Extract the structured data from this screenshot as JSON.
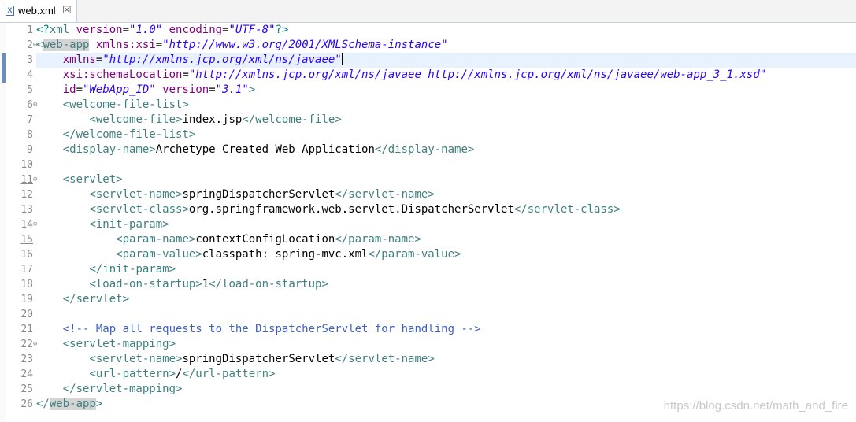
{
  "tab": {
    "title": "web.xml",
    "icon": "xml-file-icon",
    "close": "☒"
  },
  "watermark": "https://blog.csdn.net/math_and_fire",
  "lines": [
    {
      "n": "1",
      "fold": false,
      "u": false,
      "cur": false,
      "tokens": [
        [
          "pi",
          "<?"
        ],
        [
          "tag",
          "xml "
        ],
        [
          "attr",
          "version"
        ],
        [
          "txt",
          "="
        ],
        [
          "val",
          "\"1.0\""
        ],
        [
          "txt",
          " "
        ],
        [
          "attr",
          "encoding"
        ],
        [
          "txt",
          "="
        ],
        [
          "val",
          "\"UTF-8\""
        ],
        [
          "pi",
          "?>"
        ]
      ]
    },
    {
      "n": "2",
      "fold": true,
      "u": false,
      "cur": false,
      "tokens": [
        [
          "tag",
          "<"
        ],
        [
          "tag-hl",
          "web-app"
        ],
        [
          "txt",
          " "
        ],
        [
          "attr",
          "xmlns:xsi"
        ],
        [
          "txt",
          "="
        ],
        [
          "val",
          "\"http://www.w3.org/2001/XMLSchema-instance\""
        ]
      ]
    },
    {
      "n": "3",
      "fold": false,
      "u": false,
      "cur": true,
      "tokens": [
        [
          "txt",
          "    "
        ],
        [
          "attr",
          "xmlns"
        ],
        [
          "txt",
          "="
        ],
        [
          "val",
          "\"http://xmlns.jcp.org/xml/ns/javaee\""
        ],
        [
          "caret",
          ""
        ]
      ]
    },
    {
      "n": "4",
      "fold": false,
      "u": false,
      "cur": false,
      "tokens": [
        [
          "txt",
          "    "
        ],
        [
          "attr",
          "xsi:schemaLocation"
        ],
        [
          "txt",
          "="
        ],
        [
          "val",
          "\"http://xmlns.jcp.org/xml/ns/javaee http://xmlns.jcp.org/xml/ns/javaee/web-app_3_1.xsd\""
        ]
      ]
    },
    {
      "n": "5",
      "fold": false,
      "u": false,
      "cur": false,
      "tokens": [
        [
          "txt",
          "    "
        ],
        [
          "attr",
          "id"
        ],
        [
          "txt",
          "="
        ],
        [
          "val",
          "\"WebApp_ID\""
        ],
        [
          "txt",
          " "
        ],
        [
          "attr",
          "version"
        ],
        [
          "txt",
          "="
        ],
        [
          "val",
          "\"3.1\""
        ],
        [
          "tag",
          ">"
        ]
      ]
    },
    {
      "n": "6",
      "fold": true,
      "u": false,
      "cur": false,
      "tokens": [
        [
          "txt",
          "    "
        ],
        [
          "tag",
          "<welcome-file-list>"
        ]
      ]
    },
    {
      "n": "7",
      "fold": false,
      "u": false,
      "cur": false,
      "tokens": [
        [
          "txt",
          "        "
        ],
        [
          "tag",
          "<welcome-file>"
        ],
        [
          "txt",
          "index.jsp"
        ],
        [
          "tag",
          "</welcome-file>"
        ]
      ]
    },
    {
      "n": "8",
      "fold": false,
      "u": false,
      "cur": false,
      "tokens": [
        [
          "txt",
          "    "
        ],
        [
          "tag",
          "</welcome-file-list>"
        ]
      ]
    },
    {
      "n": "9",
      "fold": false,
      "u": false,
      "cur": false,
      "tokens": [
        [
          "txt",
          "    "
        ],
        [
          "tag",
          "<display-name>"
        ],
        [
          "txt",
          "Archetype Created Web Application"
        ],
        [
          "tag",
          "</display-name>"
        ]
      ]
    },
    {
      "n": "10",
      "fold": false,
      "u": false,
      "cur": false,
      "tokens": []
    },
    {
      "n": "11",
      "fold": true,
      "u": true,
      "cur": false,
      "tokens": [
        [
          "txt",
          "    "
        ],
        [
          "tag",
          "<servlet>"
        ]
      ]
    },
    {
      "n": "12",
      "fold": false,
      "u": false,
      "cur": false,
      "tokens": [
        [
          "txt",
          "        "
        ],
        [
          "tag",
          "<servlet-name>"
        ],
        [
          "txt",
          "springDispatcherServlet"
        ],
        [
          "tag",
          "</servlet-name>"
        ]
      ]
    },
    {
      "n": "13",
      "fold": false,
      "u": false,
      "cur": false,
      "tokens": [
        [
          "txt",
          "        "
        ],
        [
          "tag",
          "<servlet-class>"
        ],
        [
          "txt",
          "org.springframework.web.servlet.DispatcherServlet"
        ],
        [
          "tag",
          "</servlet-class>"
        ]
      ]
    },
    {
      "n": "14",
      "fold": true,
      "u": false,
      "cur": false,
      "tokens": [
        [
          "txt",
          "        "
        ],
        [
          "tag",
          "<init-param>"
        ]
      ]
    },
    {
      "n": "15",
      "fold": false,
      "u": true,
      "cur": false,
      "tokens": [
        [
          "txt",
          "            "
        ],
        [
          "tag",
          "<param-name>"
        ],
        [
          "txt",
          "contextConfigLocation"
        ],
        [
          "tag",
          "</param-name>"
        ]
      ]
    },
    {
      "n": "16",
      "fold": false,
      "u": false,
      "cur": false,
      "tokens": [
        [
          "txt",
          "            "
        ],
        [
          "tag",
          "<param-value>"
        ],
        [
          "txt",
          "classpath: spring-mvc.xml"
        ],
        [
          "tag",
          "</param-value>"
        ]
      ]
    },
    {
      "n": "17",
      "fold": false,
      "u": false,
      "cur": false,
      "tokens": [
        [
          "txt",
          "        "
        ],
        [
          "tag",
          "</init-param>"
        ]
      ]
    },
    {
      "n": "18",
      "fold": false,
      "u": false,
      "cur": false,
      "tokens": [
        [
          "txt",
          "        "
        ],
        [
          "tag",
          "<load-on-startup>"
        ],
        [
          "txt",
          "1"
        ],
        [
          "tag",
          "</load-on-startup>"
        ]
      ]
    },
    {
      "n": "19",
      "fold": false,
      "u": false,
      "cur": false,
      "tokens": [
        [
          "txt",
          "    "
        ],
        [
          "tag",
          "</servlet>"
        ]
      ]
    },
    {
      "n": "20",
      "fold": false,
      "u": false,
      "cur": false,
      "tokens": []
    },
    {
      "n": "21",
      "fold": false,
      "u": false,
      "cur": false,
      "tokens": [
        [
          "txt",
          "    "
        ],
        [
          "com",
          "<!-- Map all requests to the DispatcherServlet for handling -->"
        ]
      ]
    },
    {
      "n": "22",
      "fold": true,
      "u": false,
      "cur": false,
      "tokens": [
        [
          "txt",
          "    "
        ],
        [
          "tag",
          "<servlet-mapping>"
        ]
      ]
    },
    {
      "n": "23",
      "fold": false,
      "u": false,
      "cur": false,
      "tokens": [
        [
          "txt",
          "        "
        ],
        [
          "tag",
          "<servlet-name>"
        ],
        [
          "txt",
          "springDispatcherServlet"
        ],
        [
          "tag",
          "</servlet-name>"
        ]
      ]
    },
    {
      "n": "24",
      "fold": false,
      "u": false,
      "cur": false,
      "tokens": [
        [
          "txt",
          "        "
        ],
        [
          "tag",
          "<url-pattern>"
        ],
        [
          "txt",
          "/"
        ],
        [
          "tag",
          "</url-pattern>"
        ]
      ]
    },
    {
      "n": "25",
      "fold": false,
      "u": false,
      "cur": false,
      "tokens": [
        [
          "txt",
          "    "
        ],
        [
          "tag",
          "</servlet-mapping>"
        ]
      ]
    },
    {
      "n": "26",
      "fold": false,
      "u": false,
      "cur": false,
      "tokens": [
        [
          "tag",
          "</"
        ],
        [
          "tag-hl",
          "web-app"
        ],
        [
          "tag",
          ">"
        ]
      ]
    }
  ]
}
